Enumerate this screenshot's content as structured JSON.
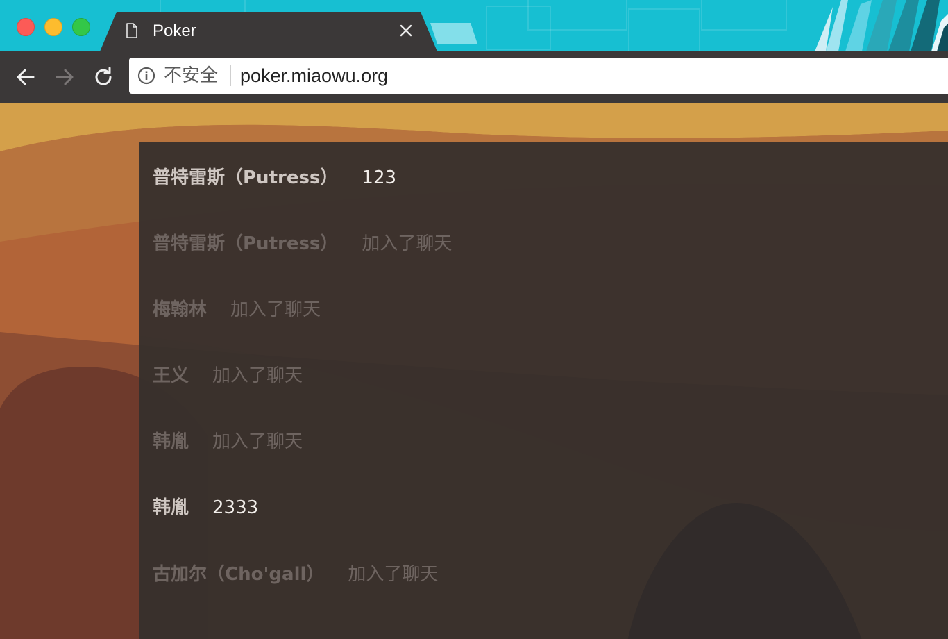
{
  "browser": {
    "tab_title": "Poker",
    "security_label": "不安全",
    "url": "poker.miaowu.org",
    "icons": {
      "tab": "document-icon",
      "close": "close-icon",
      "back": "arrow-left-icon",
      "forward": "arrow-right-icon",
      "reload": "reload-icon",
      "security": "info-icon"
    }
  },
  "chat": {
    "messages": [
      {
        "author": "普特雷斯（Putress）",
        "text": "123",
        "kind": "chat"
      },
      {
        "author": "普特雷斯（Putress）",
        "text": "加入了聊天",
        "kind": "system"
      },
      {
        "author": "梅翰林",
        "text": "加入了聊天",
        "kind": "system"
      },
      {
        "author": "王义",
        "text": "加入了聊天",
        "kind": "system"
      },
      {
        "author": "韩胤",
        "text": "加入了聊天",
        "kind": "system"
      },
      {
        "author": "韩胤",
        "text": "2333",
        "kind": "chat"
      },
      {
        "author": "古加尔（Cho'gall）",
        "text": "加入了聊天",
        "kind": "system"
      }
    ]
  },
  "colors": {
    "tabstrip": "#17bfd2",
    "toolbar": "#3b3838",
    "panel": "#342e2c",
    "chat_text": "#f2eeea",
    "system_text": "#6e6460"
  }
}
